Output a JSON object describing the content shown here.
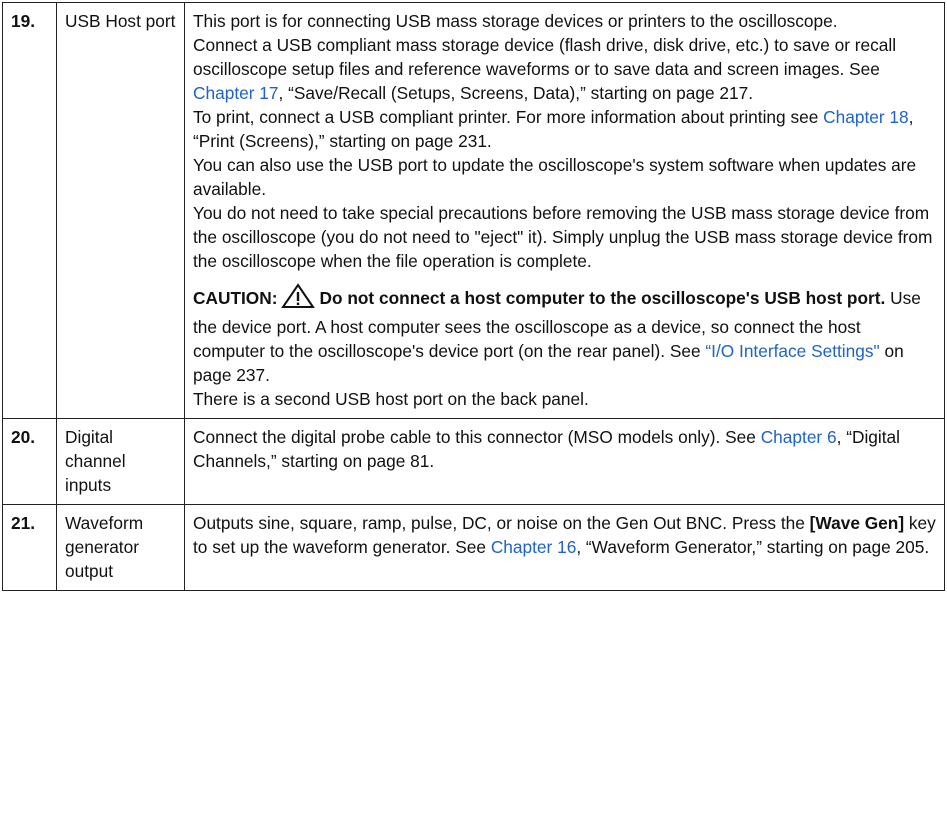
{
  "rows": [
    {
      "num": "19.",
      "label": "USB Host port",
      "p1": "This port is for connecting USB mass storage devices or printers to the oscilloscope.",
      "p2a": "Connect a USB compliant mass storage device (flash drive, disk drive, etc.) to save or recall oscilloscope setup files and reference waveforms or to save data and screen images. See ",
      "p2link": "Chapter 17",
      "p2b": ", “Save/Recall (Setups, Screens, Data),” starting on page 217.",
      "p3a": "To print, connect a USB compliant printer. For more information about printing see ",
      "p3link": "Chapter 18",
      "p3b": ", “Print (Screens),” starting on page 231.",
      "p4": "You can also use the USB port to update the oscilloscope's system software when updates are available.",
      "p5": "You do not need to take special precautions before removing the USB mass storage device from the oscilloscope (you do not need to \"eject\" it). Simply unplug the USB mass storage device from the oscilloscope when the file operation is complete.",
      "caution_label": "CAUTION:",
      "caution_icon": "warning-triangle-icon",
      "caution_bold": "Do not connect a host computer to the oscilloscope's USB host port.",
      "caution_text": " Use the device port. A host computer sees the oscilloscope as a device, so connect the host computer to the oscilloscope's device port (on the rear panel). See ",
      "caution_link": "“I/O Interface Settings\"",
      "caution_tail": " on page 237.",
      "p6": "There is a second USB host port on the back panel."
    },
    {
      "num": "20.",
      "label": "Digital channel inputs",
      "t1": "Connect the digital probe cable to this connector (MSO models only). See ",
      "link": "Chapter 6",
      "t2": ", “Digital Channels,” starting on page 81."
    },
    {
      "num": "21.",
      "label": "Waveform generator output",
      "t1": "Outputs sine, square, ramp, pulse, DC, or noise on the Gen Out BNC. Press the ",
      "key": "[Wave Gen]",
      "t2": " key to set up the waveform generator. See ",
      "link": "Chapter 16",
      "t3": ", “Waveform Generator,” starting on page 205."
    }
  ],
  "link_color": "#1f63c6"
}
